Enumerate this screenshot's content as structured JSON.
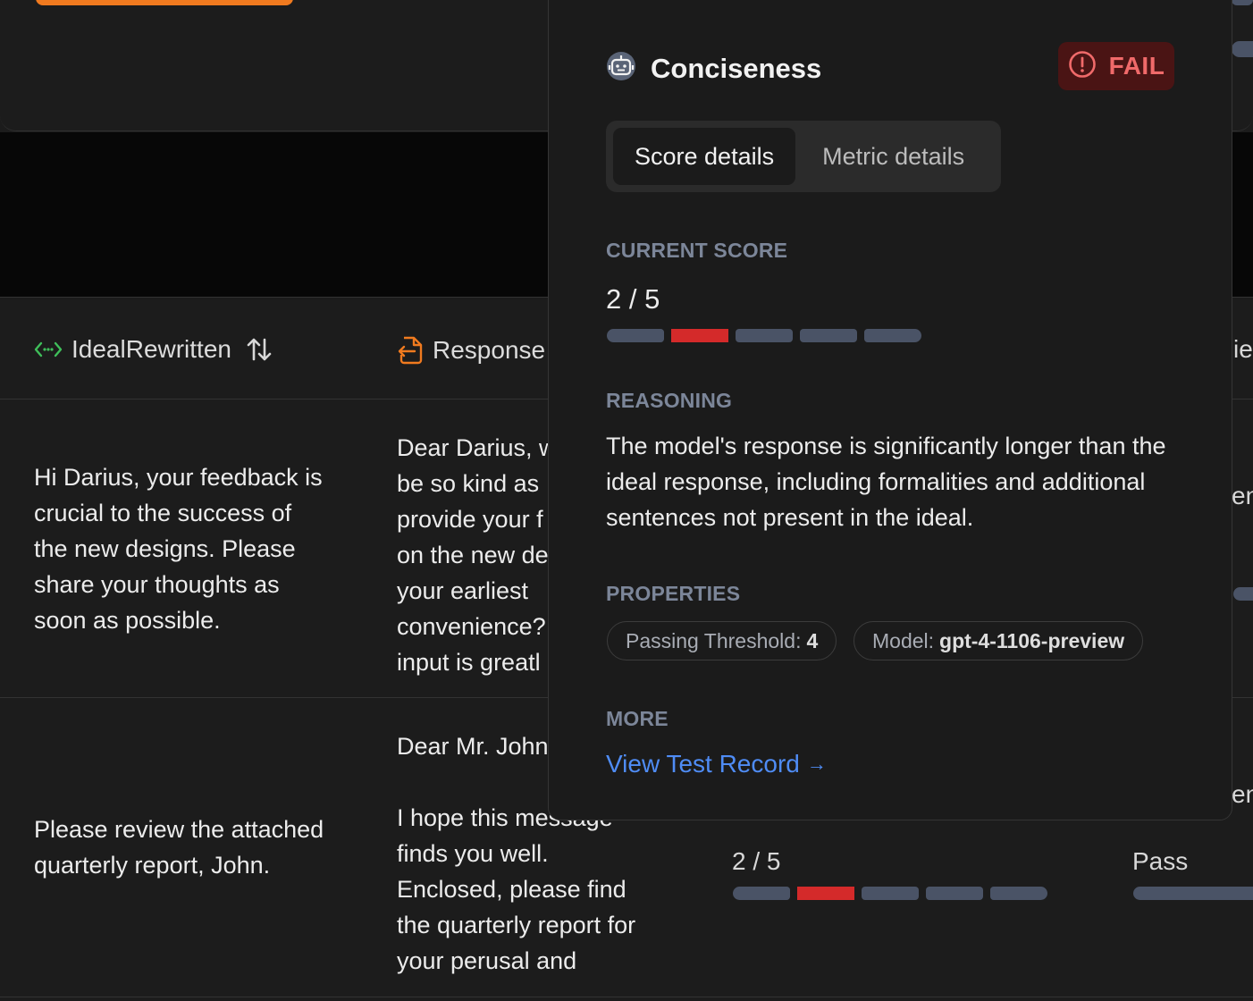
{
  "table": {
    "columns": [
      {
        "label": "IdealRewritten",
        "icon": "code-brackets-icon",
        "sortable": true
      },
      {
        "label": "Response",
        "icon": "file-import-icon"
      }
    ],
    "rows": [
      {
        "ideal": "Hi Darius, your feedback is\ncrucial to the success of\nthe new designs. Please\nshare your thoughts as\nsoon as possible.",
        "response": "Dear Darius, w\nbe so kind as \nprovide your f\non the new de\nyour earliest\nconvenience?\ninput is greatl"
      },
      {
        "ideal": "Please review the attached\nquarterly report, John.",
        "response": "Dear Mr. John\n\nI hope this message\nfinds you well.\nEnclosed, please find\nthe quarterly report for\nyour perusal and",
        "score": "2 / 5",
        "score_value": 2,
        "score_max": 5,
        "status": "Pass"
      }
    ],
    "edge_fragments": [
      "ier",
      "en",
      "en"
    ]
  },
  "popover": {
    "title": "Conciseness",
    "title_icon": "robot-icon",
    "badge": "FAIL",
    "badge_icon": "alert-circle-icon",
    "tabs": [
      {
        "label": "Score details",
        "active": true
      },
      {
        "label": "Metric details",
        "active": false
      }
    ],
    "current_score_label": "CURRENT SCORE",
    "score": "2 / 5",
    "score_value": 2,
    "score_max": 5,
    "reasoning_label": "REASONING",
    "reasoning": "The model's response is significantly longer than the ideal response, including formalities and additional sentences not present in the ideal.",
    "properties_label": "PROPERTIES",
    "properties": [
      {
        "key": "Passing Threshold:",
        "value": "4"
      },
      {
        "key": "Model:",
        "value": "gpt-4-1106-preview"
      }
    ],
    "more_label": "MORE",
    "link": "View Test Record",
    "link_arrow": "→"
  },
  "colors": {
    "accent_orange": "#f07a1f",
    "fail_red": "#d42a2a",
    "link_blue": "#4f8cf5",
    "bar_gray": "#4a5366",
    "code_green": "#3fbf5a"
  }
}
